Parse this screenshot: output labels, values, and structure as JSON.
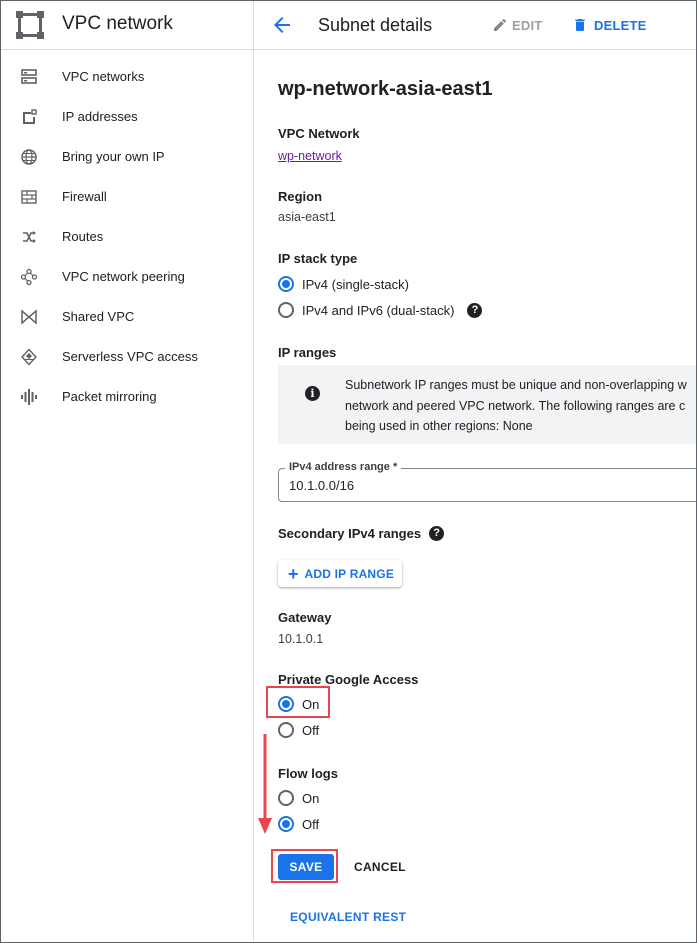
{
  "sidebar": {
    "title": "VPC network",
    "items": [
      {
        "label": "VPC networks",
        "icon": "vpc-networks-icon"
      },
      {
        "label": "IP addresses",
        "icon": "ip-addresses-icon"
      },
      {
        "label": "Bring your own IP",
        "icon": "globe-icon"
      },
      {
        "label": "Firewall",
        "icon": "firewall-icon"
      },
      {
        "label": "Routes",
        "icon": "routes-icon"
      },
      {
        "label": "VPC network peering",
        "icon": "peering-icon"
      },
      {
        "label": "Shared VPC",
        "icon": "shared-vpc-icon"
      },
      {
        "label": "Serverless VPC access",
        "icon": "serverless-icon"
      },
      {
        "label": "Packet mirroring",
        "icon": "packet-mirroring-icon"
      }
    ]
  },
  "header": {
    "title": "Subnet details",
    "edit_label": "EDIT",
    "delete_label": "DELETE"
  },
  "subnet": {
    "name": "wp-network-asia-east1",
    "vpc_network_label": "VPC Network",
    "vpc_network_value": "wp-network",
    "region_label": "Region",
    "region_value": "asia-east1",
    "ip_stack_label": "IP stack type",
    "ip_stack_options": [
      "IPv4 (single-stack)",
      "IPv4 and IPv6 (dual-stack)"
    ],
    "ip_stack_selected": "IPv4 (single-stack)",
    "help_glyph": "?",
    "ip_ranges_label": "IP ranges",
    "info_glyph": "i",
    "info_lines": [
      "Subnetwork IP ranges must be unique and non-overlapping w",
      "network and peered VPC network. The following ranges are c",
      "being used in other regions: None"
    ],
    "ipv4_field_label": "IPv4 address range *",
    "ipv4_field_value": "10.1.0.0/16",
    "secondary_label": "Secondary IPv4 ranges",
    "add_range_label": "ADD IP RANGE",
    "add_range_plus": "+",
    "gateway_label": "Gateway",
    "gateway_value": "10.1.0.1",
    "pga_label": "Private Google Access",
    "pga_on": "On",
    "pga_off": "Off",
    "pga_selected": "On",
    "flow_logs_label": "Flow logs",
    "flow_on": "On",
    "flow_off": "Off",
    "flow_selected": "Off"
  },
  "actions": {
    "save": "SAVE",
    "cancel": "CANCEL",
    "equivalent_rest": "EQUIVALENT REST"
  },
  "colors": {
    "accent": "#1a73e8",
    "link": "#681da8",
    "highlight": "#e8454f"
  }
}
